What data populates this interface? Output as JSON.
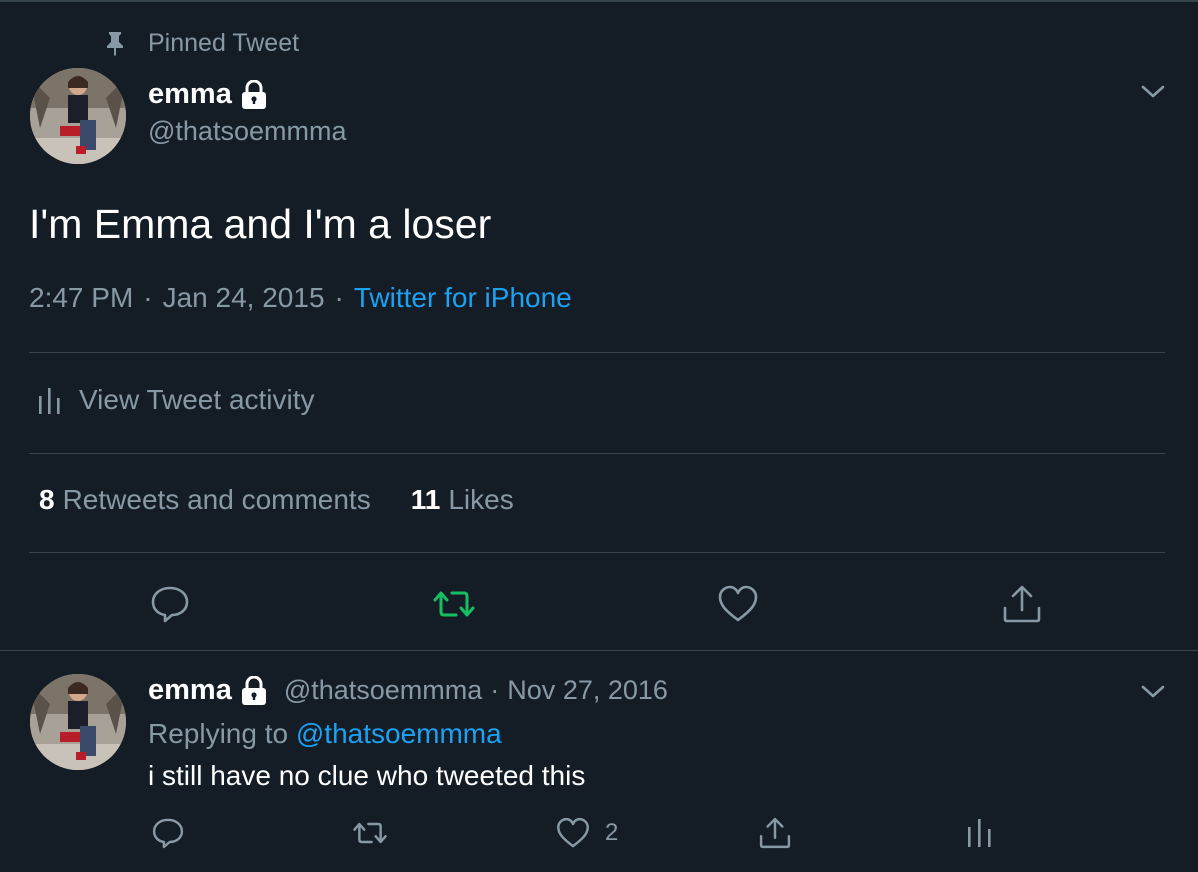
{
  "pinned": {
    "label": "Pinned Tweet",
    "icon": "pin-icon"
  },
  "tweet": {
    "author_name": "emma",
    "author_handle": "@thatsoemmma",
    "text": "I'm Emma and I'm a loser",
    "time": "2:47 PM",
    "date": "Jan 24, 2015",
    "separator": "·",
    "source": "Twitter for iPhone",
    "activity_label": "View Tweet activity",
    "retweets_count": "8",
    "retweets_label": "Retweets and comments",
    "likes_count": "11",
    "likes_label": "Likes",
    "actions": [
      "reply-icon",
      "retweet-icon",
      "like-icon",
      "share-icon"
    ],
    "retweet_active_color": "#17bf63"
  },
  "reply": {
    "author_name": "emma",
    "author_handle": "@thatsoemmma",
    "separator": "·",
    "date": "Nov 27, 2016",
    "replying_prefix": "Replying to",
    "replying_handle": "@thatsoemmma",
    "text": "i still have no clue who tweeted this",
    "like_count": "2",
    "actions": [
      "reply-icon",
      "retweet-icon",
      "like-icon",
      "share-icon",
      "activity-icon"
    ]
  },
  "colors": {
    "background": "#141d26",
    "muted": "#8899a6",
    "accent_blue": "#1da1f2",
    "divider": "#38444d"
  }
}
